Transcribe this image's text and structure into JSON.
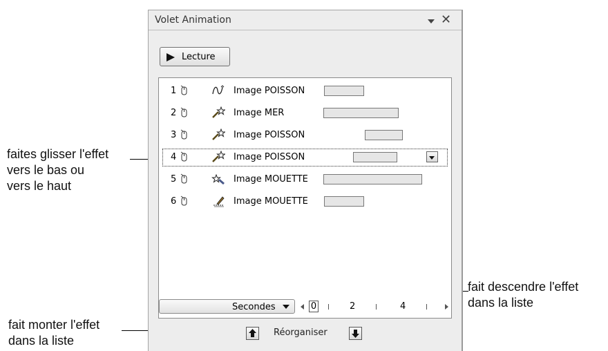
{
  "pane": {
    "title": "Volet Animation",
    "play_label": "Lecture",
    "reorder_label": "Réorganiser",
    "timeline": {
      "unit_label": "Secondes",
      "scale": [
        "0",
        "2",
        "4"
      ]
    }
  },
  "effects": [
    {
      "num": "1",
      "icon": "motion-path-icon",
      "name": "Image POISSON"
    },
    {
      "num": "2",
      "icon": "emphasis-star-icon",
      "name": "Image MER"
    },
    {
      "num": "3",
      "icon": "emphasis-star-icon",
      "name": "Image POISSON"
    },
    {
      "num": "4",
      "icon": "emphasis-star-icon",
      "name": "Image POISSON",
      "selected": true
    },
    {
      "num": "5",
      "icon": "exit-star-icon",
      "name": "Image MOUETTE"
    },
    {
      "num": "6",
      "icon": "draw-path-icon",
      "name": "Image MOUETTE"
    }
  ],
  "annotations": {
    "drag": "faites glisser l'effet\nvers le bas ou\nvers le haut",
    "move_down": "fait descendre l'effet\ndans la liste",
    "move_up": "fait monter l'effet\ndans la liste"
  }
}
